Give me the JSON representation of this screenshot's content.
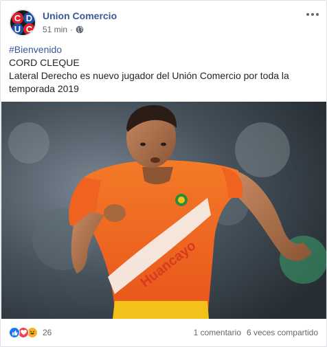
{
  "post": {
    "page_name": "Union Comercio",
    "timestamp": "51 min",
    "privacy_icon": "globe-icon",
    "avatar_letters": [
      "C",
      "D",
      "U",
      "C"
    ],
    "text": {
      "hashtag": "#Bienvenido",
      "line1": "CORD CLEQUE",
      "line2": "Lateral Derecho es nuevo jugador del Unión Comercio por toda la temporada 2019"
    },
    "photo_jersey_text": "Huancayo",
    "reactions": {
      "icons": [
        "like-icon",
        "love-icon",
        "haha-icon"
      ],
      "count": "26"
    },
    "comments": "1 comentario",
    "shares": "6 veces compartido"
  },
  "colors": {
    "link": "#385898",
    "like": "#1877f2",
    "love": "#f33e58",
    "haha": "#f7b125",
    "jersey": "#f26a1b"
  }
}
